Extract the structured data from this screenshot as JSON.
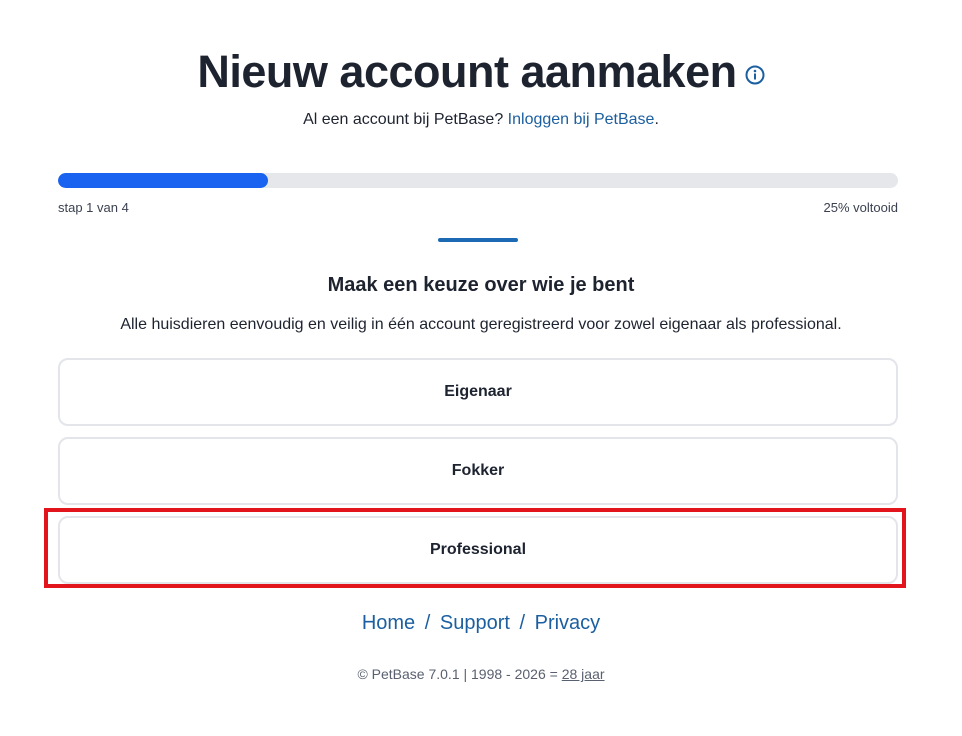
{
  "header": {
    "title": "Nieuw account aanmaken",
    "info_icon": "info-circle-icon"
  },
  "login_prompt": {
    "text": "Al een account bij PetBase?",
    "link": "Inloggen bij PetBase",
    "suffix": "."
  },
  "progress": {
    "fraction": 0.25,
    "step_label": "stap 1 van 4",
    "percent_label": "25% voltooid",
    "track_color": "#e5e7eb",
    "fill_color": "#1a62f0"
  },
  "section": {
    "title": "Maak een keuze over wie je bent",
    "description": "Alle huisdieren eenvoudig en veilig in één account geregistreerd voor zowel eigenaar als professional."
  },
  "options": [
    {
      "label": "Eigenaar"
    },
    {
      "label": "Fokker"
    },
    {
      "label": "Professional",
      "highlighted": true
    }
  ],
  "highlight_color": "#e3151c",
  "footer": {
    "links": [
      "Home",
      "Support",
      "Privacy"
    ],
    "separator": "/",
    "copyright_text": "© PetBase 7.0.1 | 1998 - 2026 =",
    "copyright_years": "28 jaar"
  },
  "colors": {
    "link": "#1c5fa0",
    "text": "#1e2330"
  }
}
